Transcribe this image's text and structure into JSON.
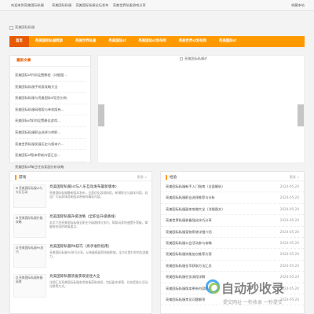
{
  "topbar": {
    "welcome": "欢迎来到亮美国际私服",
    "links": [
      "亮美国际私服",
      "亮美国际私服论坛发布",
      "亮美世界私服游戏分享"
    ],
    "favorite": "收藏本站"
  },
  "logo": {
    "alt": "亮美国际私服"
  },
  "nav": {
    "items": [
      "首页",
      "亮美国际私服网游",
      "亮美世界私服",
      "亮美国际sf",
      "亮美国际sf发布网",
      "亮美世界sf发布网",
      "亮美国际sf"
    ]
  },
  "sidebar": {
    "title": "最新文章",
    "items": [
      "亮美国际sf代码设置教程（详细图...",
      "亮美国际私服手机版攻略大全",
      "亮美国际私服与亮美国际sf区别分析",
      "亮美国际私服网络版与单机版有...",
      "亮美国际sf如何设置最佳游戏...",
      "亮美国际私服职业选择与转职...",
      "亮美世界私服发展历史与版本介...",
      "亮美国际sf版本更新内容汇总...",
      "亮美国际sf每日任务奖励分析攻略"
    ]
  },
  "banner": {
    "alt": "亮美国际私服sf"
  },
  "games": {
    "title": "游戏",
    "more": "更多 »",
    "items": [
      {
        "thumb": "亮美国际私服sf与大乐互动",
        "title": "亮美国际私服(sf与八乐互动发布最新版本)",
        "desc": "亮美国际私服最新版本发布，全面优化游戏体验，新增职业与副本内容，欢迎广大玩家体验新版本带来的精彩内容。"
      },
      {
        "thumb": "亮美国际私服升级攻略",
        "title": "亮美国际私服升级攻略（全职业升级路线）",
        "desc": "本文介绍亮美国际私服全职业升级路线与技巧，帮助玩家快速提升等级，掌握各阶段的练级要点。"
      },
      {
        "thumb": "亮美国际私服PK技巧",
        "title": "亮美国际私服PK技巧（高手进阶指南）",
        "desc": "亮美国际私服PK技巧分享，从装备搭配到技能释放，全方位提升你的实战能力。"
      },
      {
        "thumb": "亮美国际私服装备获取",
        "title": "亮美国际私服装备获取途径大全",
        "desc": "详细汇总亮美国际私服各类装备获取途径，包括副本掉落、任务奖励与活动兑换等方式。"
      }
    ]
  },
  "experience": {
    "title": "经验",
    "more": "更多 »",
    "items": [
      {
        "title": "亮美国际私服新手入门指南（全面解析）",
        "date": "2024-05-20"
      },
      {
        "title": "亮美国际私服职业选择推荐与分析",
        "date": "2024-05-20"
      },
      {
        "title": "亮美国际私服副本攻略大全（详细图文）",
        "date": "2024-05-20"
      },
      {
        "title": "亮美世界私服装备强化技巧分享",
        "date": "2024-05-20"
      },
      {
        "title": "亮美国际私服宠物系统详细介绍",
        "date": "2024-05-20"
      },
      {
        "title": "亮美国际私服公会活动参与攻略",
        "date": "2024-05-20"
      },
      {
        "title": "亮美国际私服技能加点推荐方案",
        "date": "2024-05-20"
      },
      {
        "title": "亮美国际私服金币获取方法汇总",
        "date": "2024-05-20"
      },
      {
        "title": "亮美国际私服任务流程详解",
        "date": "2024-05-20"
      },
      {
        "title": "亮美国际私服版本更新内容解读",
        "date": "2024-05-20"
      },
      {
        "title": "亮美国际私服常见问题解答",
        "date": "2024-05-20"
      }
    ]
  },
  "watermark": {
    "main": "自动秒收录",
    "sub": "提交网址 一秒收录 一秒提交"
  }
}
